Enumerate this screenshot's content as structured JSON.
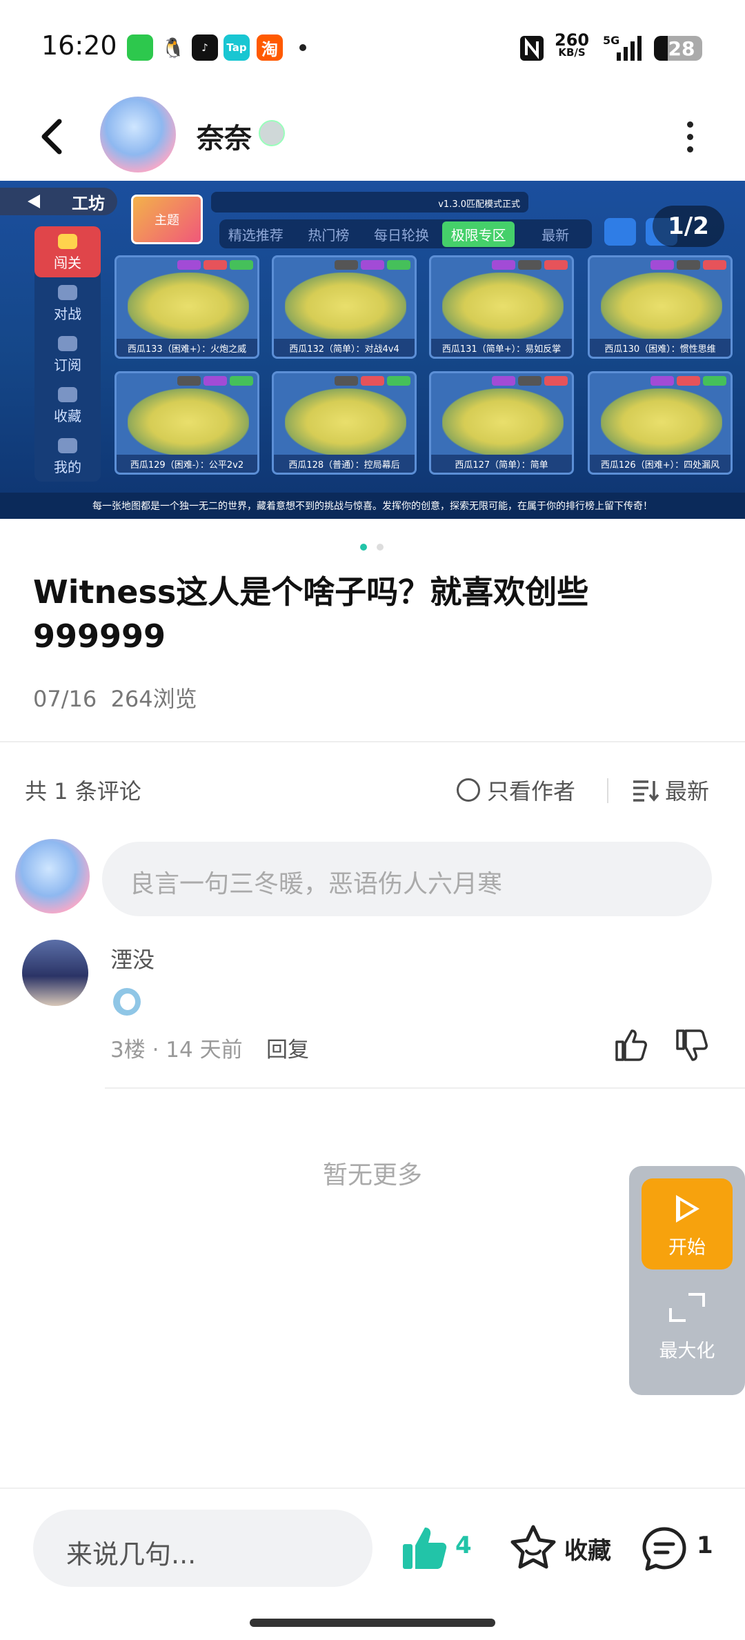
{
  "status_bar": {
    "time": "16:20",
    "apps": [
      {
        "icon": "wechat-icon",
        "color": "#2dc84d",
        "label": ""
      },
      {
        "icon": "qq-icon",
        "color": "#222222",
        "label": ""
      },
      {
        "icon": "tiktok-icon",
        "color": "#111111",
        "label": ""
      },
      {
        "icon": "taptap-icon",
        "color": "#19c6d2",
        "label": "Tap"
      },
      {
        "icon": "taobao-icon",
        "color": "#ff5a00",
        "label": "淘"
      }
    ],
    "net_speed_value": "260",
    "net_speed_unit": "KB/S",
    "network": "5G",
    "battery": "28"
  },
  "header": {
    "username": "奈奈"
  },
  "banner": {
    "pager": "1/2",
    "panel_title": "工坊",
    "thumb_label": "主题",
    "version_text": "v1.3.0匹配模式正式",
    "sidebar": [
      "闯关",
      "对战",
      "订阅",
      "收藏",
      "我的"
    ],
    "tabs": [
      "精选推荐",
      "热门榜",
      "每日轮换",
      "极限专区",
      "最新"
    ],
    "active_tab": 3,
    "cards": [
      "西瓜133（困难+）：火炮之威",
      "西瓜132（简单）：对战4v4",
      "西瓜131（简单+）：易如反掌",
      "西瓜130（困难）：惯性思维",
      "西瓜129（困难-）：公平2v2",
      "西瓜128（普通）：控局幕后",
      "西瓜127（简单）：简单",
      "西瓜126（困难+）：四处漏风"
    ],
    "footer_text": "每一张地图都是一个独一无二的世界，藏着意想不到的挑战与惊喜。发挥你的创意，探索无限可能，在属于你的排行榜上留下传奇！"
  },
  "post": {
    "title": "Witness这人是个啥子吗？就喜欢创些999999",
    "date": "07/16",
    "views": "264浏览"
  },
  "comments_header": {
    "count": "共 1 条评论",
    "only_author": "只看作者",
    "sort": "最新"
  },
  "comment_input_placeholder": "良言一句三冬暖，恶语伤人六月寒",
  "comment": {
    "author": "湮没",
    "floor": "3楼 · 14 天前",
    "reply": "回复"
  },
  "no_more": "暂无更多",
  "float_panel": {
    "start": "开始",
    "maximize": "最大化"
  },
  "bottom_bar": {
    "input_placeholder": "来说几句...",
    "like_count": "4",
    "favorite": "收藏",
    "comment_count": "1"
  },
  "colors": {
    "accent": "#22c4a8",
    "start_button": "#f7a20d"
  }
}
